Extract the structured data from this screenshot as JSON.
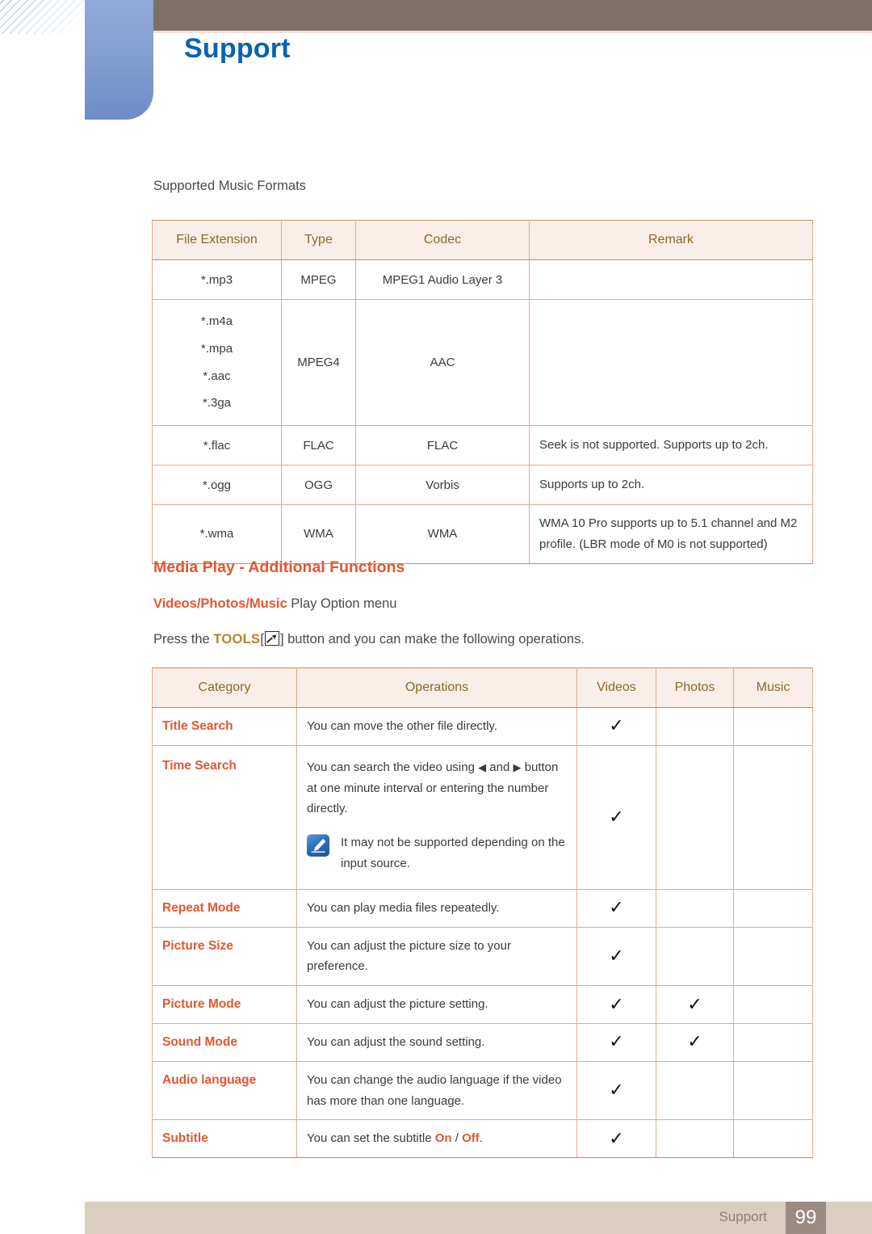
{
  "header": {
    "title": "Support"
  },
  "music_section": {
    "label": "Supported Music Formats",
    "table": {
      "columns": [
        "File Extension",
        "Type",
        "Codec",
        "Remark"
      ],
      "rows": [
        {
          "ext": "*.mp3",
          "type": "MPEG",
          "codec": "MPEG1 Audio Layer 3",
          "remark": ""
        },
        {
          "ext": "*.m4a\n*.mpa\n*.aac\n*.3ga",
          "type": "MPEG4",
          "codec": "AAC",
          "remark": ""
        },
        {
          "ext": "*.flac",
          "type": "FLAC",
          "codec": "FLAC",
          "remark": "Seek is not supported. Supports up to 2ch."
        },
        {
          "ext": "*.ogg",
          "type": "OGG",
          "codec": "Vorbis",
          "remark": "Supports up to 2ch."
        },
        {
          "ext": "*.wma",
          "type": "WMA",
          "codec": "WMA",
          "remark": "WMA 10 Pro supports up to 5.1 channel and M2 profile. (LBR mode of M0 is not supported)"
        }
      ],
      "ext_lines": {
        "row0": [
          "*.mp3"
        ],
        "row1": [
          "*.m4a",
          "*.mpa",
          "*.aac",
          "*.3ga"
        ],
        "row2": [
          "*.flac"
        ],
        "row3": [
          "*.ogg"
        ],
        "row4": [
          "*.wma"
        ]
      }
    }
  },
  "media_section": {
    "heading": "Media Play - Additional Functions",
    "subline": {
      "videos": "Videos",
      "sep1": "/",
      "photos": "Photos",
      "sep2": "/",
      "music": "Music",
      "rest": " Play Option menu"
    },
    "press_line": {
      "before": "Press the ",
      "tools": "TOOLS",
      "bracket_open": "[",
      "bracket_close": "]",
      "after": " button and you can make the following operations."
    },
    "table": {
      "columns": [
        "Category",
        "Operations",
        "Videos",
        "Photos",
        "Music"
      ],
      "check_glyph": "✓",
      "rows": [
        {
          "category": "Title Search",
          "operations": "You can move the other file directly.",
          "videos": true,
          "photos": false,
          "music": false
        },
        {
          "category": "Time Search",
          "operations_pre": "You can search the video using ",
          "arrow_left": "◀",
          "operations_mid": " and ",
          "arrow_right": "▶",
          "operations_post": " button at one minute interval or entering the number directly.",
          "note": "It may not be supported depending on the input source.",
          "note_icon": "note-pencil-icon",
          "videos": true,
          "photos": false,
          "music": false
        },
        {
          "category": "Repeat Mode",
          "operations": "You can play media files repeatedly.",
          "videos": true,
          "photos": false,
          "music": false
        },
        {
          "category": "Picture Size",
          "operations": "You can adjust the picture size to your preference.",
          "videos": true,
          "photos": false,
          "music": false
        },
        {
          "category": "Picture Mode",
          "operations": "You can adjust the picture setting.",
          "videos": true,
          "photos": true,
          "music": false
        },
        {
          "category": "Sound Mode",
          "operations": "You can adjust the sound setting.",
          "videos": true,
          "photos": true,
          "music": false
        },
        {
          "category": "Audio language",
          "operations": "You can change the audio language if the video has more than one language.",
          "videos": true,
          "photos": false,
          "music": false
        },
        {
          "category": "Subtitle",
          "operations_pre": "You can set the subtitle ",
          "on": "On",
          "slash": " / ",
          "off": "Off",
          "operations_post": ".",
          "videos": true,
          "photos": false,
          "music": false
        }
      ]
    }
  },
  "footer": {
    "label": "Support",
    "page_number": "99"
  },
  "colors": {
    "title_blue": "#0b62b0",
    "accent_orange": "#e4572e",
    "table_header_bg": "#faeee8",
    "table_header_text": "#8a6a2a",
    "table_border": "#e8a98c",
    "topbar_brown": "#7d7064",
    "footer_bar": "#d9cec0",
    "footer_page_bg": "#9c8b80"
  }
}
